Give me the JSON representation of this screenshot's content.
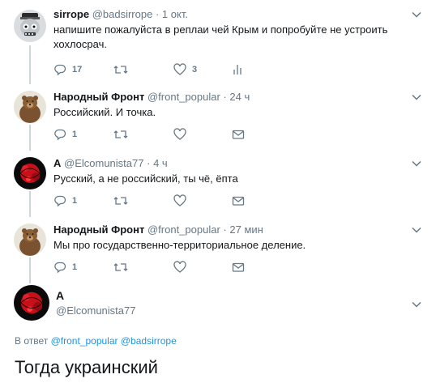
{
  "tweets": [
    {
      "name": "sirrope",
      "handle": "@badsirrope",
      "time": "1 окт.",
      "text": "напишите пожалуйста в реплаи чей Крым и попробуйте не устроить хохлосрач.",
      "replies": "17",
      "likes": "3"
    },
    {
      "name": "Народный Фронт",
      "handle": "@front_popular",
      "time": "24 ч",
      "text": "Российский. И точка.",
      "replies": "1"
    },
    {
      "name": "А",
      "handle": "@Elcomunista77",
      "time": "4 ч",
      "text": "Русский, а не российский, ты чё, ёпта",
      "replies": "1"
    },
    {
      "name": "Народный Фронт",
      "handle": "@front_popular",
      "time": "27 мин",
      "text": "Мы про государственно-территориальное деление.",
      "replies": "1"
    }
  ],
  "main": {
    "name": "А",
    "handle": "@Elcomunista77",
    "reply_prefix": "В ответ",
    "reply_user1": "@front_popular",
    "reply_user2": "@badsirrope",
    "text": "Тогда украинский"
  },
  "dot": "·",
  "colors": {
    "link": "#1b95e0",
    "muted": "#657786",
    "line": "#ccd6dd"
  }
}
